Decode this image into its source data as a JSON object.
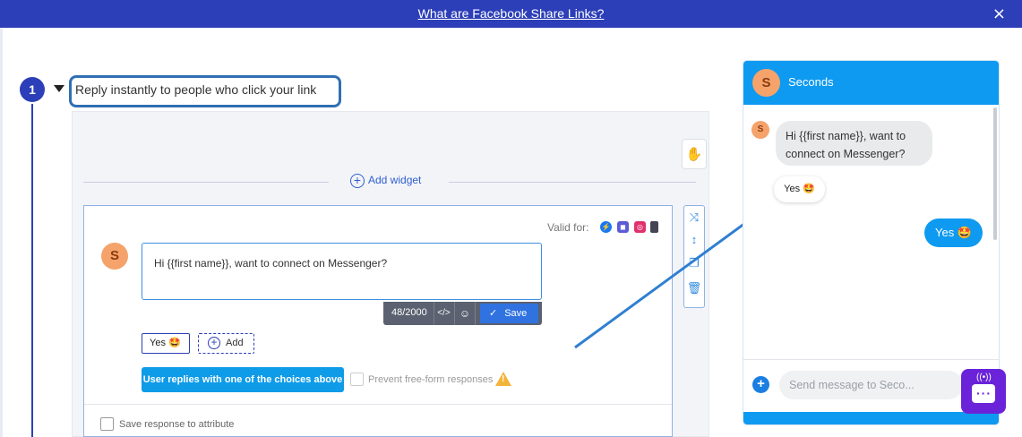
{
  "banner": {
    "link_text": "What are Facebook Share Links?",
    "close_icon": "×"
  },
  "step": {
    "number": "1",
    "title": "Reply instantly to people who click your link"
  },
  "canvas": {
    "add_widget_label": "Add widget"
  },
  "widget": {
    "valid_for_label": "Valid for:",
    "avatar_letter": "S",
    "message_text": "Hi {{first name}}, want to connect on Messenger?",
    "char_count": "48/2000",
    "code_icon": "</>",
    "save_label": "Save",
    "choices": [
      {
        "label": "Yes 🤩"
      }
    ],
    "add_choice_label": "Add",
    "replies_button_label": "User replies with one of the choices above",
    "prevent_label": "Prevent free-form responses",
    "save_attr_label": "Save response to attribute"
  },
  "preview": {
    "page_name": "Seconds",
    "avatar_letter": "S",
    "bot_message": "Hi {{first name}}, want to connect on Messenger?",
    "quick_reply": "Yes 🤩",
    "user_reply": "Yes 🤩",
    "input_placeholder": "Send message to Seco..."
  },
  "colors": {
    "brand_blue": "#2c3fb8",
    "messenger_blue": "#0e9af0",
    "chat_fab": "#6a23d9"
  }
}
